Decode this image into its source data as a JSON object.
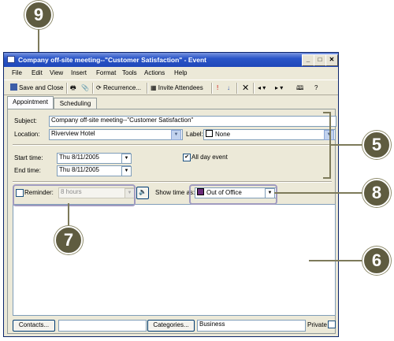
{
  "callouts": {
    "c9": "9",
    "c5": "5",
    "c8": "8",
    "c7": "7",
    "c6": "6"
  },
  "window": {
    "title": "Company off-site meeting--\"Customer Satisfaction\" - Event"
  },
  "menu": [
    "File",
    "Edit",
    "View",
    "Insert",
    "Format",
    "Tools",
    "Actions",
    "Help"
  ],
  "toolbar": {
    "save_close": "Save and Close",
    "recurrence": "Recurrence...",
    "invite": "Invite Attendees"
  },
  "tabs": {
    "appointment": "Appointment",
    "scheduling": "Scheduling"
  },
  "form": {
    "subject_label": "Subject:",
    "subject_value": "Company off-site meeting--\"Customer Satisfaction\"",
    "location_label": "Location:",
    "location_value": "Riverview Hotel",
    "label_label": "Label:",
    "label_value": "None",
    "start_label": "Start time:",
    "start_value": "Thu 8/11/2005",
    "end_label": "End time:",
    "end_value": "Thu 8/11/2005",
    "allday_label": "All day event",
    "reminder_label": "Reminder:",
    "reminder_value": "8 hours",
    "showtime_label": "Show time as:",
    "showtime_value": "Out of Office"
  },
  "footer": {
    "contacts": "Contacts...",
    "categories": "Categories...",
    "categories_value": "Business",
    "private_label": "Private"
  },
  "colors": {
    "accent": "#5f5c40",
    "highlight": "#a09bc0",
    "outofoffice": "#6b2c7a"
  }
}
